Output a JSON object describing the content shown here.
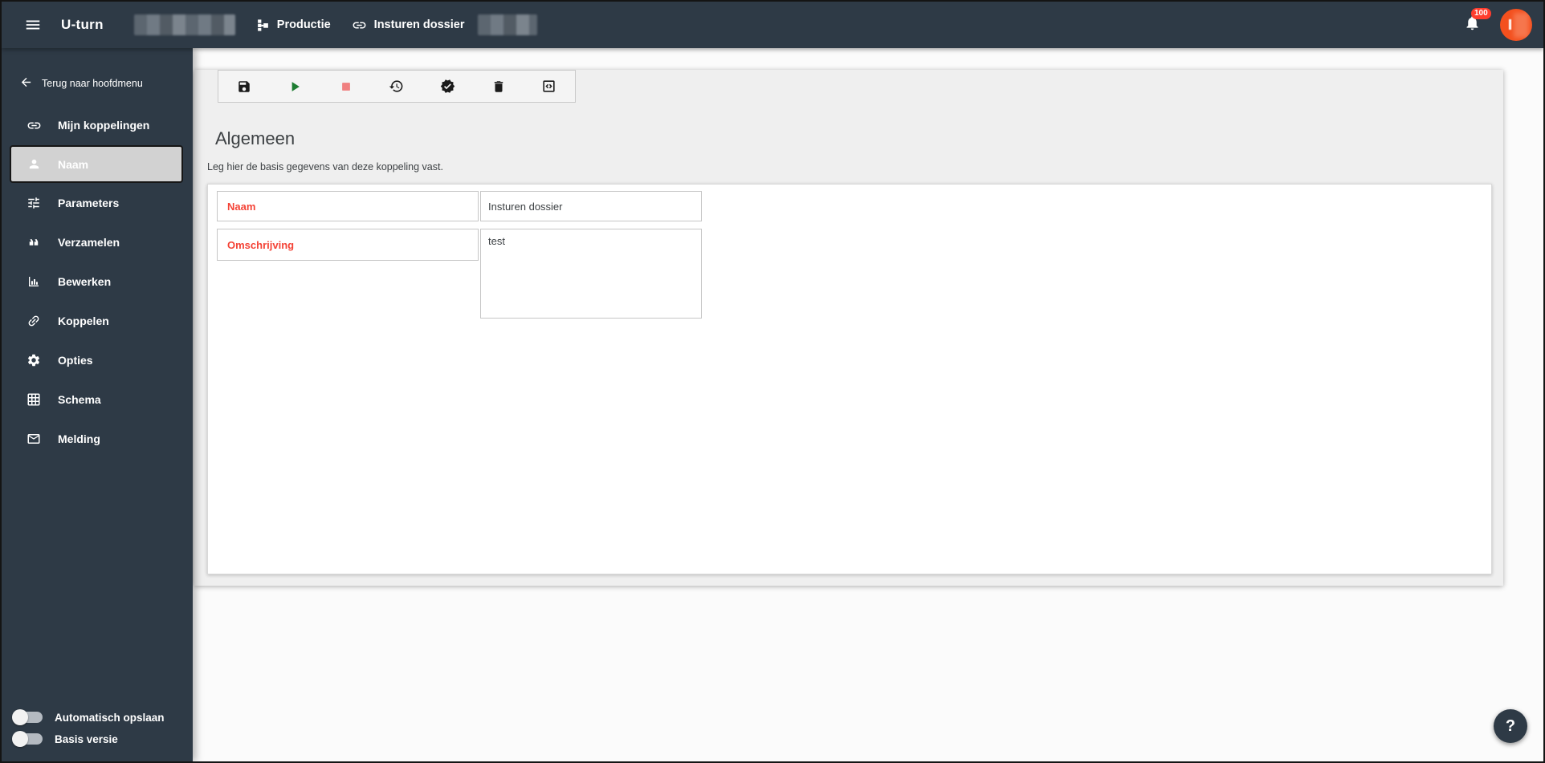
{
  "header": {
    "app_title": "U-turn",
    "environment_label": "Productie",
    "koppeling_label": "Insturen dossier",
    "notifications_count": "100"
  },
  "sidebar": {
    "back_label": "Terug naar hoofdmenu",
    "items": [
      {
        "label": "Mijn koppelingen",
        "icon": "link-icon",
        "selected": false
      },
      {
        "label": "Naam",
        "icon": "person-icon",
        "selected": true
      },
      {
        "label": "Parameters",
        "icon": "tune-icon",
        "selected": false
      },
      {
        "label": "Verzamelen",
        "icon": "quote-icon",
        "selected": false
      },
      {
        "label": "Bewerken",
        "icon": "bar-chart-icon",
        "selected": false
      },
      {
        "label": "Koppelen",
        "icon": "chain-icon",
        "selected": false
      },
      {
        "label": "Opties",
        "icon": "gear-icon",
        "selected": false
      },
      {
        "label": "Schema",
        "icon": "grid-icon",
        "selected": false
      },
      {
        "label": "Melding",
        "icon": "mail-icon",
        "selected": false
      }
    ],
    "toggles": [
      {
        "label": "Automatisch opslaan",
        "on": false
      },
      {
        "label": "Basis versie",
        "on": false
      }
    ]
  },
  "toolbar": {
    "buttons": [
      "save",
      "run",
      "stop",
      "history",
      "validate",
      "delete",
      "code"
    ]
  },
  "main": {
    "section_title": "Algemeen",
    "section_subtitle": "Leg hier de basis gegevens van deze koppeling vast.",
    "form": {
      "fields": [
        {
          "label": "Naam",
          "value": "Insturen dossier",
          "type": "input"
        },
        {
          "label": "Omschrijving",
          "value": "test",
          "type": "textarea"
        }
      ]
    }
  },
  "help": {
    "label": "?"
  },
  "colors": {
    "header_bg": "#2e3a46",
    "accent_red": "#f44336",
    "avatar_orange": "#f4501e",
    "badge_red": "#ff3d2e",
    "play_green": "#1e7d32",
    "stop_pink": "#f08080",
    "selected_item_bg": "#d2d2d2"
  }
}
